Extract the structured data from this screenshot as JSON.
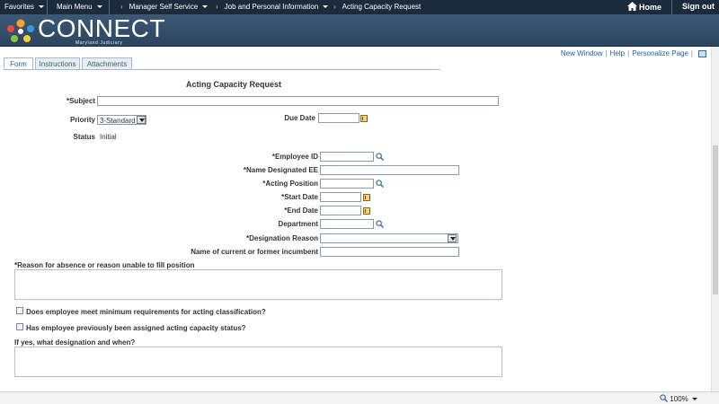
{
  "topnav": {
    "favorites": "Favorites",
    "main_menu": "Main Menu",
    "crumbs": [
      "Manager Self Service",
      "Job and Personal Information",
      "Acting Capacity Request"
    ],
    "home": "Home",
    "signout": "Sign out"
  },
  "banner": {
    "logo": "CONNECT",
    "subtitle": "Maryland Judiciary"
  },
  "links": {
    "new_window": "New Window",
    "help": "Help",
    "personalize": "Personalize Page"
  },
  "tabs": [
    "Form",
    "Instructions",
    "Attachments"
  ],
  "form": {
    "title": "Acting Capacity Request",
    "subject_label": "*Subject",
    "priority_label": "Priority",
    "priority_value": "3-Standard",
    "due_date_label": "Due Date",
    "status_label": "Status",
    "status_value": "Initial",
    "employee_id": "*Employee ID",
    "name_designated": "*Name Designated EE",
    "acting_position": "*Acting Position",
    "start_date": "*Start Date",
    "end_date": "*End Date",
    "department": "Department",
    "designation_reason": "*Designation Reason",
    "incumbent": "Name of current or former incumbent",
    "reason_absence": "*Reason for absence or reason unable to fill position",
    "min_requirements": "Does employee meet minimum requirements for acting classification?",
    "previously_assigned": "Has employee previously been assigned acting capacity status?",
    "designation_when": "If yes, what designation and when?"
  },
  "statusbar": {
    "zoom": "100%"
  },
  "colors": {
    "navbar": "#1c2b3b",
    "banner": "#3d5874",
    "link": "#2060a8"
  }
}
